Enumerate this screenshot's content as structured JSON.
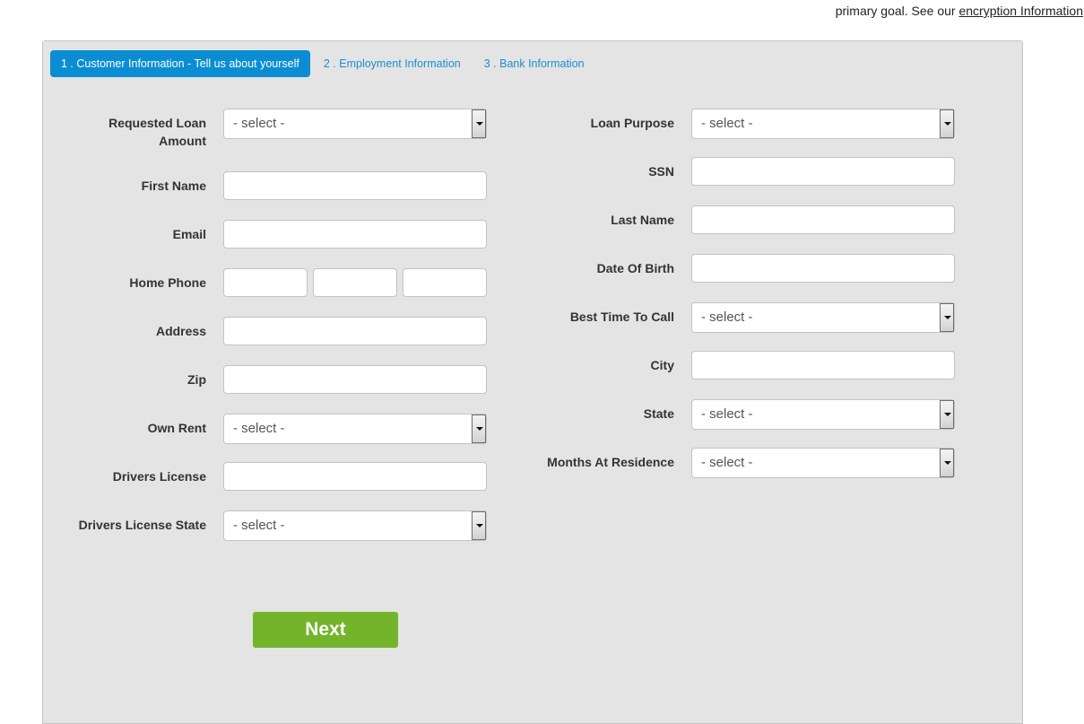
{
  "top_note": {
    "text": "primary goal. See our ",
    "link_label": "encryption Information"
  },
  "tabs": [
    {
      "label": "1 . Customer Information - Tell us about yourself",
      "active": true
    },
    {
      "label": "2 . Employment Information",
      "active": false
    },
    {
      "label": "3 . Bank Information",
      "active": false
    }
  ],
  "left_fields": {
    "requested_loan_amount": {
      "label": "Requested Loan Amount",
      "value": "- select -"
    },
    "first_name": {
      "label": "First Name",
      "value": ""
    },
    "email": {
      "label": "Email",
      "value": ""
    },
    "home_phone": {
      "label": "Home Phone",
      "values": [
        "",
        "",
        ""
      ]
    },
    "address": {
      "label": "Address",
      "value": ""
    },
    "zip": {
      "label": "Zip",
      "value": ""
    },
    "own_rent": {
      "label": "Own Rent",
      "value": "- select -"
    },
    "drivers_license": {
      "label": "Drivers License",
      "value": ""
    },
    "drivers_license_state": {
      "label": "Drivers License State",
      "value": "- select -"
    }
  },
  "right_fields": {
    "loan_purpose": {
      "label": "Loan Purpose",
      "value": "- select -"
    },
    "ssn": {
      "label": "SSN",
      "value": ""
    },
    "last_name": {
      "label": "Last Name",
      "value": ""
    },
    "date_of_birth": {
      "label": "Date Of Birth",
      "value": ""
    },
    "best_time_to_call": {
      "label": "Best Time To Call",
      "value": "- select -"
    },
    "city": {
      "label": "City",
      "value": ""
    },
    "state": {
      "label": "State",
      "value": "- select -"
    },
    "months_at_residence": {
      "label": "Months At Residence",
      "value": "- select -"
    }
  },
  "next_button": {
    "label": "Next"
  },
  "colors": {
    "active_tab": "#0a8dd2",
    "tab_link": "#1a8fd0",
    "next_button": "#73b42a",
    "panel_bg": "#e4e4e4"
  }
}
